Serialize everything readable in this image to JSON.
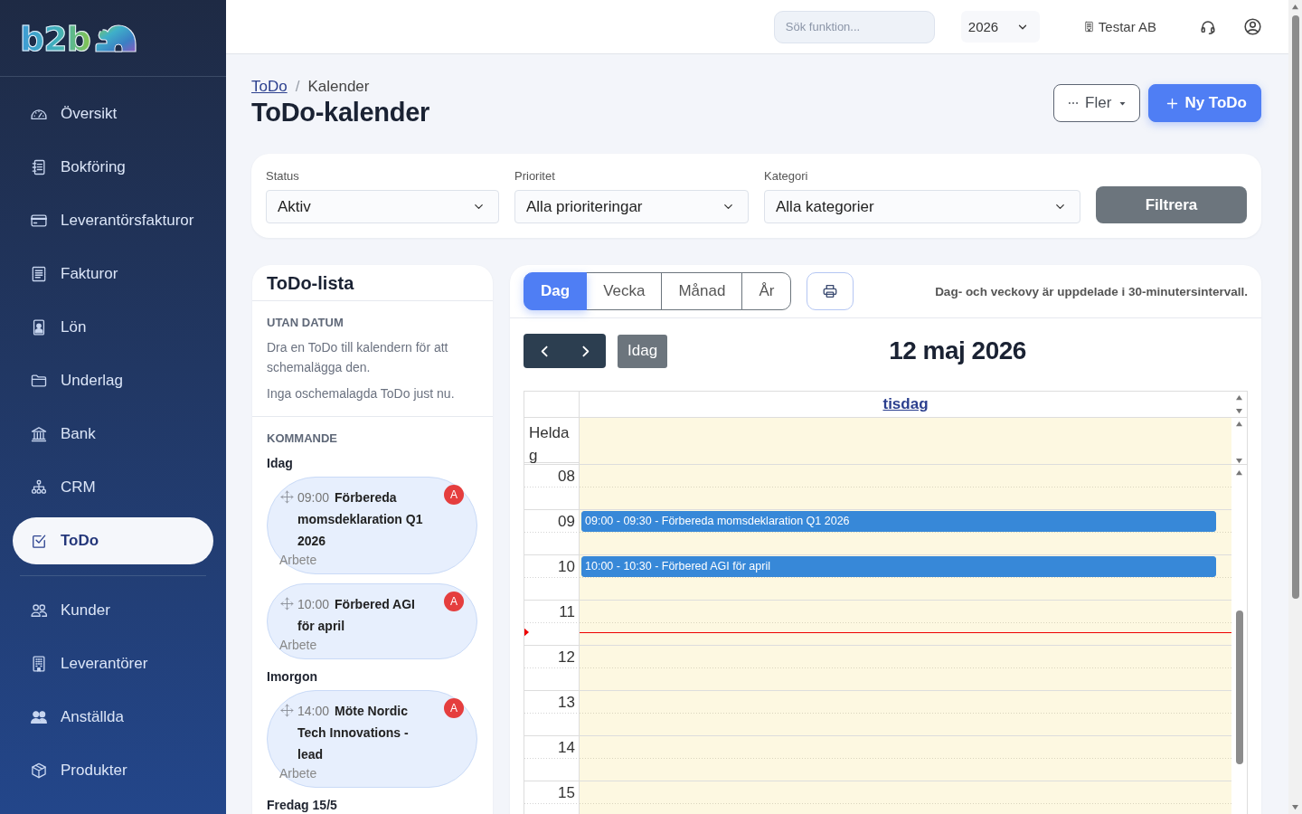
{
  "sidebar": {
    "logo": {
      "text": "b2b"
    },
    "sections": [
      {
        "items": [
          {
            "label": "Översikt",
            "selected": false
          },
          {
            "label": "Bokföring",
            "selected": false
          },
          {
            "label": "Leverantörsfakturor",
            "selected": false
          },
          {
            "label": "Fakturor",
            "selected": false
          },
          {
            "label": "Lön",
            "selected": false
          },
          {
            "label": "Underlag",
            "selected": false
          },
          {
            "label": "Bank",
            "selected": false
          },
          {
            "label": "CRM",
            "selected": false
          },
          {
            "label": "ToDo",
            "selected": true
          }
        ]
      },
      {
        "items": [
          {
            "label": "Kunder",
            "selected": false
          },
          {
            "label": "Leverantörer",
            "selected": false
          },
          {
            "label": "Anställda",
            "selected": false
          },
          {
            "label": "Produkter",
            "selected": false
          }
        ]
      }
    ]
  },
  "topbar": {
    "search": {
      "placeholder": "Sök funktion..."
    },
    "year_select": {
      "value": "2026"
    },
    "company": "Testar AB"
  },
  "header": {
    "breadcrumb": {
      "separator": "/",
      "items": [
        {
          "label": "ToDo",
          "kind": "link"
        },
        {
          "label": "Kalender",
          "kind": "current"
        }
      ]
    },
    "title": "ToDo-kalender",
    "actions": [
      {
        "label": "Fler",
        "kind": "menu"
      },
      {
        "label": "Ny ToDo",
        "kind": "primary"
      }
    ]
  },
  "filters": {
    "fields": [
      {
        "label": "Status",
        "value": "Aktiv"
      },
      {
        "label": "Prioritet",
        "value": "Alla prioriteringar"
      },
      {
        "label": "Kategori",
        "value": "Alla kategorier"
      }
    ],
    "submit": "Filtrera"
  },
  "todo_list": {
    "title": "ToDo-lista",
    "unscheduled": {
      "heading": "UTAN DATUM",
      "hint": "Dra en ToDo till kalendern för att schemalägga den.",
      "empty_text": "Inga oschemalagda ToDo just nu."
    },
    "upcoming": {
      "heading": "KOMMANDE",
      "groups": [
        {
          "label": "Idag",
          "items": [
            {
              "time": "09:00",
              "title": "Förbereda momsdeklaration Q1 2026",
              "category": "Arbete",
              "badge": "A"
            },
            {
              "time": "10:00",
              "title": "Förbered AGI för april",
              "category": "Arbete",
              "badge": "A"
            }
          ]
        },
        {
          "label": "Imorgon",
          "items": [
            {
              "time": "14:00",
              "title": "Möte Nordic Tech Innovations - lead",
              "category": "Arbete",
              "badge": "A"
            }
          ]
        },
        {
          "label": "Fredag 15/5"
        }
      ]
    }
  },
  "calendar": {
    "views": [
      {
        "label": "Dag",
        "selected": true
      },
      {
        "label": "Vecka",
        "selected": false
      },
      {
        "label": "Månad",
        "selected": false
      },
      {
        "label": "År",
        "selected": false
      }
    ],
    "hint": "Dag- och veckovy är uppdelade i 30-minutersintervall.",
    "today_button": "Idag",
    "date_title": "12 maj 2026",
    "day_header": "tisdag",
    "all_day_label": "Heldag",
    "hours": [
      {
        "label": "08",
        "now": false
      },
      {
        "label": "09",
        "now": false,
        "events": [
          {
            "text": "09:00 - 09:30 - Förbereda momsdeklaration Q1 2026"
          }
        ]
      },
      {
        "label": "10",
        "now": false,
        "events": [
          {
            "text": "10:00 - 10:30 - Förbered AGI för april"
          }
        ]
      },
      {
        "label": "11",
        "now": true
      },
      {
        "label": "12",
        "now": false
      },
      {
        "label": "13",
        "now": false
      },
      {
        "label": "14",
        "now": false
      },
      {
        "label": "15",
        "now": false
      }
    ]
  }
}
